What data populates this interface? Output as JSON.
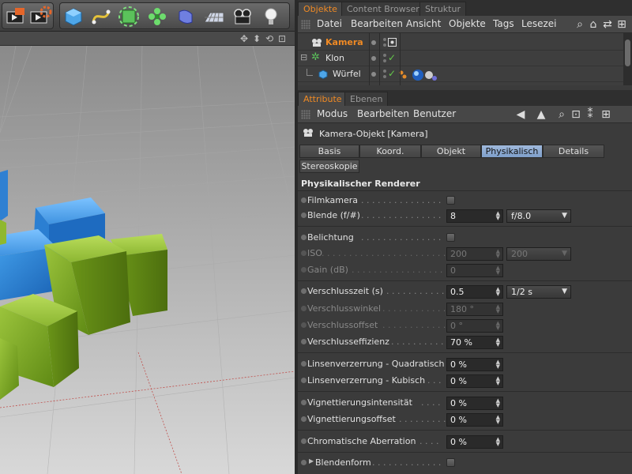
{
  "toolbar": {
    "icons": [
      "render-view-icon",
      "render-settings-icon",
      "cube-icon",
      "spline-icon",
      "generator-icon",
      "mograph-cloner-icon",
      "deformer-icon",
      "floor-icon",
      "camera-icon",
      "light-icon"
    ]
  },
  "viewport": {
    "nav_icons": [
      "✥",
      "⬍",
      "⟲",
      "⊡"
    ]
  },
  "object_manager": {
    "tabs": [
      "Objekte",
      "Content Browser",
      "Struktur"
    ],
    "menu": [
      "Datei",
      "Bearbeiten",
      "Ansicht",
      "Objekte",
      "Tags",
      "Lesezei"
    ],
    "objects": [
      {
        "name": "Kamera",
        "selected": true,
        "icon": "camera-icon"
      },
      {
        "name": "Klon",
        "selected": false,
        "icon": "cloner-icon"
      },
      {
        "name": "Würfel",
        "selected": false,
        "icon": "cube-icon"
      }
    ]
  },
  "attribute_manager": {
    "tabs": [
      "Attribute",
      "Ebenen"
    ],
    "menu": [
      "Modus",
      "Bearbeiten",
      "Benutzer"
    ],
    "object_title": "Kamera-Objekt [Kamera]",
    "sub_tabs": [
      "Basis",
      "Koord.",
      "Objekt",
      "Physikalisch",
      "Details",
      "Stereoskopie"
    ],
    "active_sub_tab": "Physikalisch",
    "section_title": "Physikalischer Renderer",
    "params": {
      "filmkamera": {
        "label": "Filmkamera"
      },
      "blende": {
        "label": "Blende (f/#)",
        "value": "8",
        "select": "f/8.0"
      },
      "belichtung": {
        "label": "Belichtung"
      },
      "iso": {
        "label": "ISO",
        "value": "200",
        "select": "200"
      },
      "gain": {
        "label": "Gain (dB)",
        "value": "0"
      },
      "verschlusszeit": {
        "label": "Verschlusszeit (s)",
        "value": "0.5",
        "select": "1/2 s"
      },
      "verschlusswinkel": {
        "label": "Verschlusswinkel",
        "value": "180 °"
      },
      "verschlussoffset": {
        "label": "Verschlussoffset",
        "value": "0 °"
      },
      "verschlusseffizienz": {
        "label": "Verschlusseffizienz",
        "value": "70 %"
      },
      "linsen_quad": {
        "label": "Linsenverzerrung - Quadratisch",
        "value": "0 %"
      },
      "linsen_kub": {
        "label": "Linsenverzerrung - Kubisch",
        "value": "0 %"
      },
      "vig_int": {
        "label": "Vignettierungsintensität",
        "value": "0 %"
      },
      "vig_off": {
        "label": "Vignettierungsoffset",
        "value": "0 %"
      },
      "chrom": {
        "label": "Chromatische Aberration",
        "value": "0 %"
      },
      "blendenform": {
        "label": "Blendenform"
      }
    }
  }
}
